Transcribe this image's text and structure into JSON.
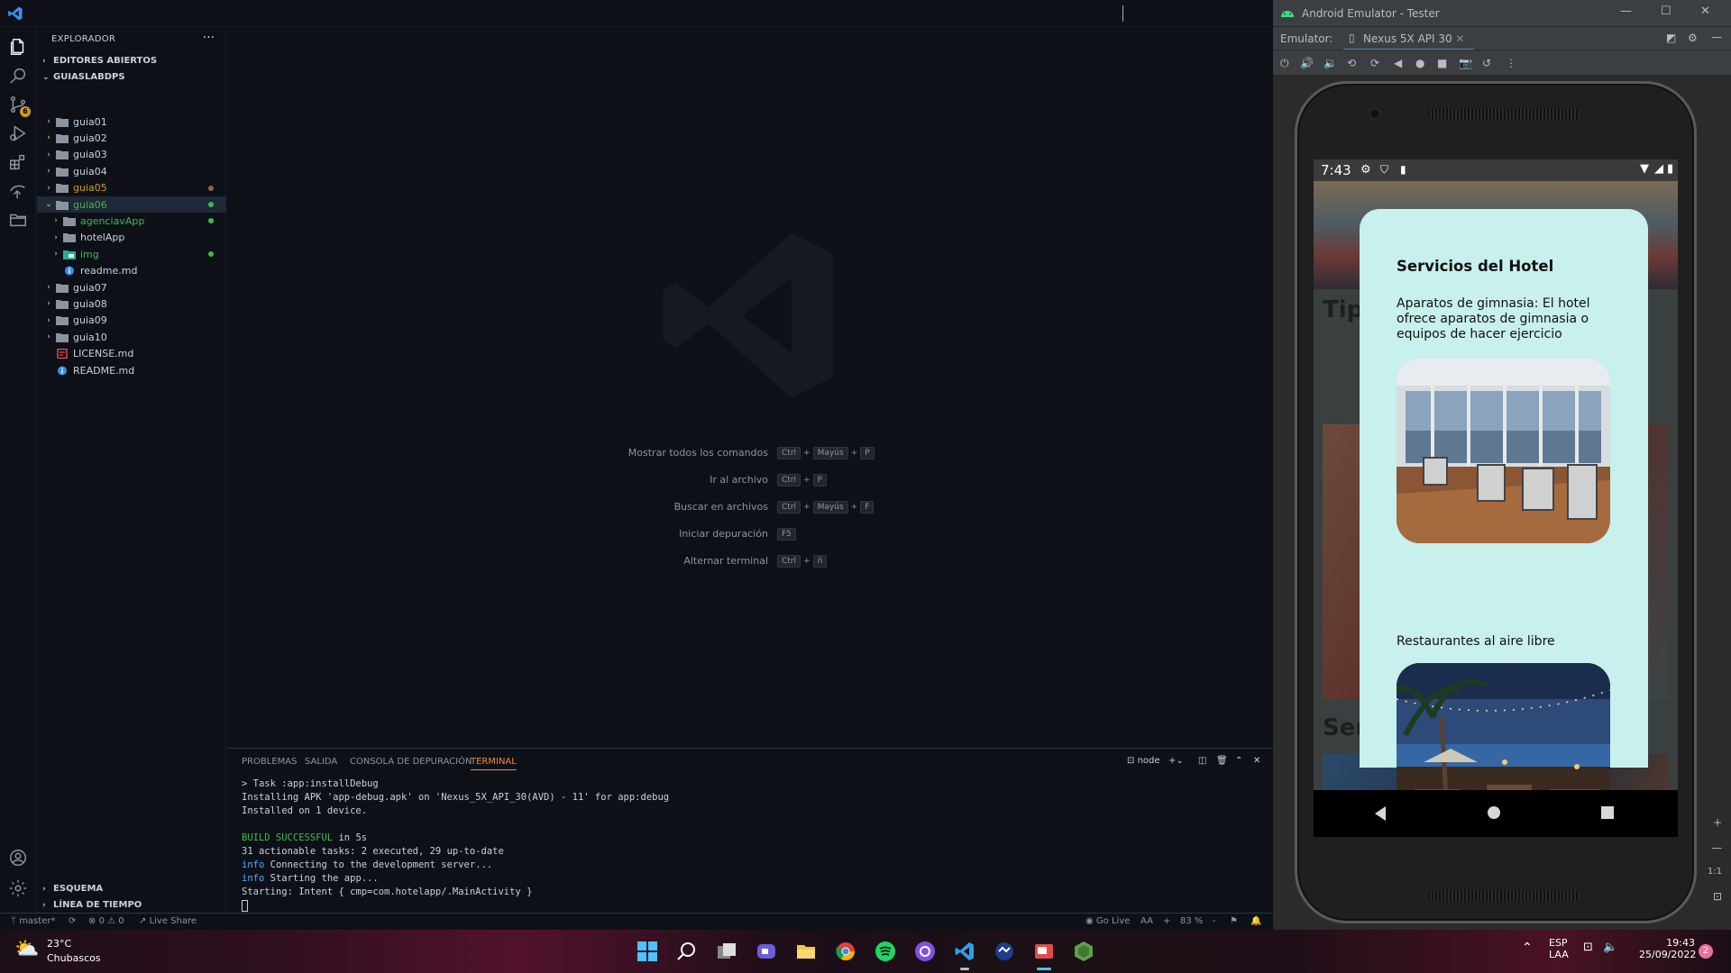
{
  "vscode": {
    "explorer_title": "EXPLORADOR",
    "open_editors": "EDITORES ABIERTOS",
    "workspace": "GUIASLABDPS",
    "tree": [
      {
        "label": "guia01",
        "type": "folder",
        "level": 0,
        "color": "#c9d1d9"
      },
      {
        "label": "guia02",
        "type": "folder",
        "level": 0,
        "color": "#c9d1d9"
      },
      {
        "label": "guia03",
        "type": "folder",
        "level": 0,
        "color": "#c9d1d9"
      },
      {
        "label": "guia04",
        "type": "folder",
        "level": 0,
        "color": "#c9d1d9"
      },
      {
        "label": "guia05",
        "type": "folder",
        "level": 0,
        "color": "#d29922",
        "dot": "#8b6d3b"
      },
      {
        "label": "guia06",
        "type": "folder-open",
        "level": 0,
        "color": "#3fb950",
        "dot": "#3fb950",
        "selected": true
      },
      {
        "label": "agenciavApp",
        "type": "folder",
        "level": 1,
        "color": "#3fb950",
        "dot": "#3fb950"
      },
      {
        "label": "hotelApp",
        "type": "folder",
        "level": 1,
        "color": "#c9d1d9"
      },
      {
        "label": "img",
        "type": "folder-img",
        "level": 1,
        "color": "#3fb950",
        "dot": "#3fb950"
      },
      {
        "label": "readme.md",
        "type": "info",
        "level": 1,
        "color": "#c9d1d9"
      },
      {
        "label": "guia07",
        "type": "folder",
        "level": 0,
        "color": "#c9d1d9"
      },
      {
        "label": "guia08",
        "type": "folder",
        "level": 0,
        "color": "#c9d1d9"
      },
      {
        "label": "guia09",
        "type": "folder",
        "level": 0,
        "color": "#c9d1d9"
      },
      {
        "label": "guia10",
        "type": "folder",
        "level": 0,
        "color": "#c9d1d9"
      },
      {
        "label": "LICENSE.md",
        "type": "license",
        "level": 0,
        "color": "#c9d1d9"
      },
      {
        "label": "README.md",
        "type": "info",
        "level": 0,
        "color": "#c9d1d9"
      }
    ],
    "outline": "ESQUEMA",
    "timeline": "LÍNEA DE TIEMPO",
    "commands": [
      {
        "label": "Mostrar todos los comandos",
        "keys": [
          "Ctrl",
          "Mayús",
          "P"
        ]
      },
      {
        "label": "Ir al archivo",
        "keys": [
          "Ctrl",
          "P"
        ]
      },
      {
        "label": "Buscar en archivos",
        "keys": [
          "Ctrl",
          "Mayús",
          "F"
        ]
      },
      {
        "label": "Iniciar depuración",
        "keys": [
          "F5"
        ]
      },
      {
        "label": "Alternar terminal",
        "keys": [
          "Ctrl",
          "ñ"
        ]
      }
    ],
    "panel_tabs": [
      "PROBLEMAS",
      "SALIDA",
      "CONSOLA DE DEPURACIÓN",
      "TERMINAL"
    ],
    "terminal_name": "node",
    "terminal_lines": [
      {
        "text": "> Task :app:installDebug"
      },
      {
        "text": "Installing APK 'app-debug.apk' on 'Nexus_5X_API_30(AVD) - 11' for app:debug"
      },
      {
        "text": "Installed on 1 device."
      },
      {
        "text": ""
      },
      {
        "prefix": "BUILD SUCCESSFUL",
        "text": " in 5s",
        "style": "green"
      },
      {
        "text": "31 actionable tasks: 2 executed, 29 up-to-date"
      },
      {
        "prefix": "info",
        "text": " Connecting to the development server...",
        "style": "blue"
      },
      {
        "prefix": "info",
        "text": " Starting the app...",
        "style": "blue"
      },
      {
        "text": "Starting: Intent { cmp=com.hotelapp/.MainActivity }"
      }
    ],
    "status": {
      "branch": "master*",
      "errors": "0",
      "warnings": "0",
      "live_share": "Live Share",
      "go_live": "Go Live",
      "font": "AA",
      "zoom": "83 %"
    }
  },
  "emulator": {
    "title": "Android Emulator - Tester",
    "label": "Emulator:",
    "device_tab": "Nexus 5X API 30",
    "time": "7:43",
    "ratio": "1:1",
    "bg_texts": [
      "Tipo",
      "Ser"
    ],
    "modal": {
      "title": "Servicios del Hotel",
      "description": "Aparatos de gimnasia:  El hotel ofrece aparatos de gimnasia o equipos de hacer ejercicio",
      "subtitle": "Restaurantes al aire libre"
    }
  },
  "taskbar": {
    "temp": "23°C",
    "condition": "Chubascos",
    "lang1": "ESP",
    "lang2": "LAA",
    "time": "19:43",
    "date": "25/09/2022",
    "notifications": "2"
  }
}
